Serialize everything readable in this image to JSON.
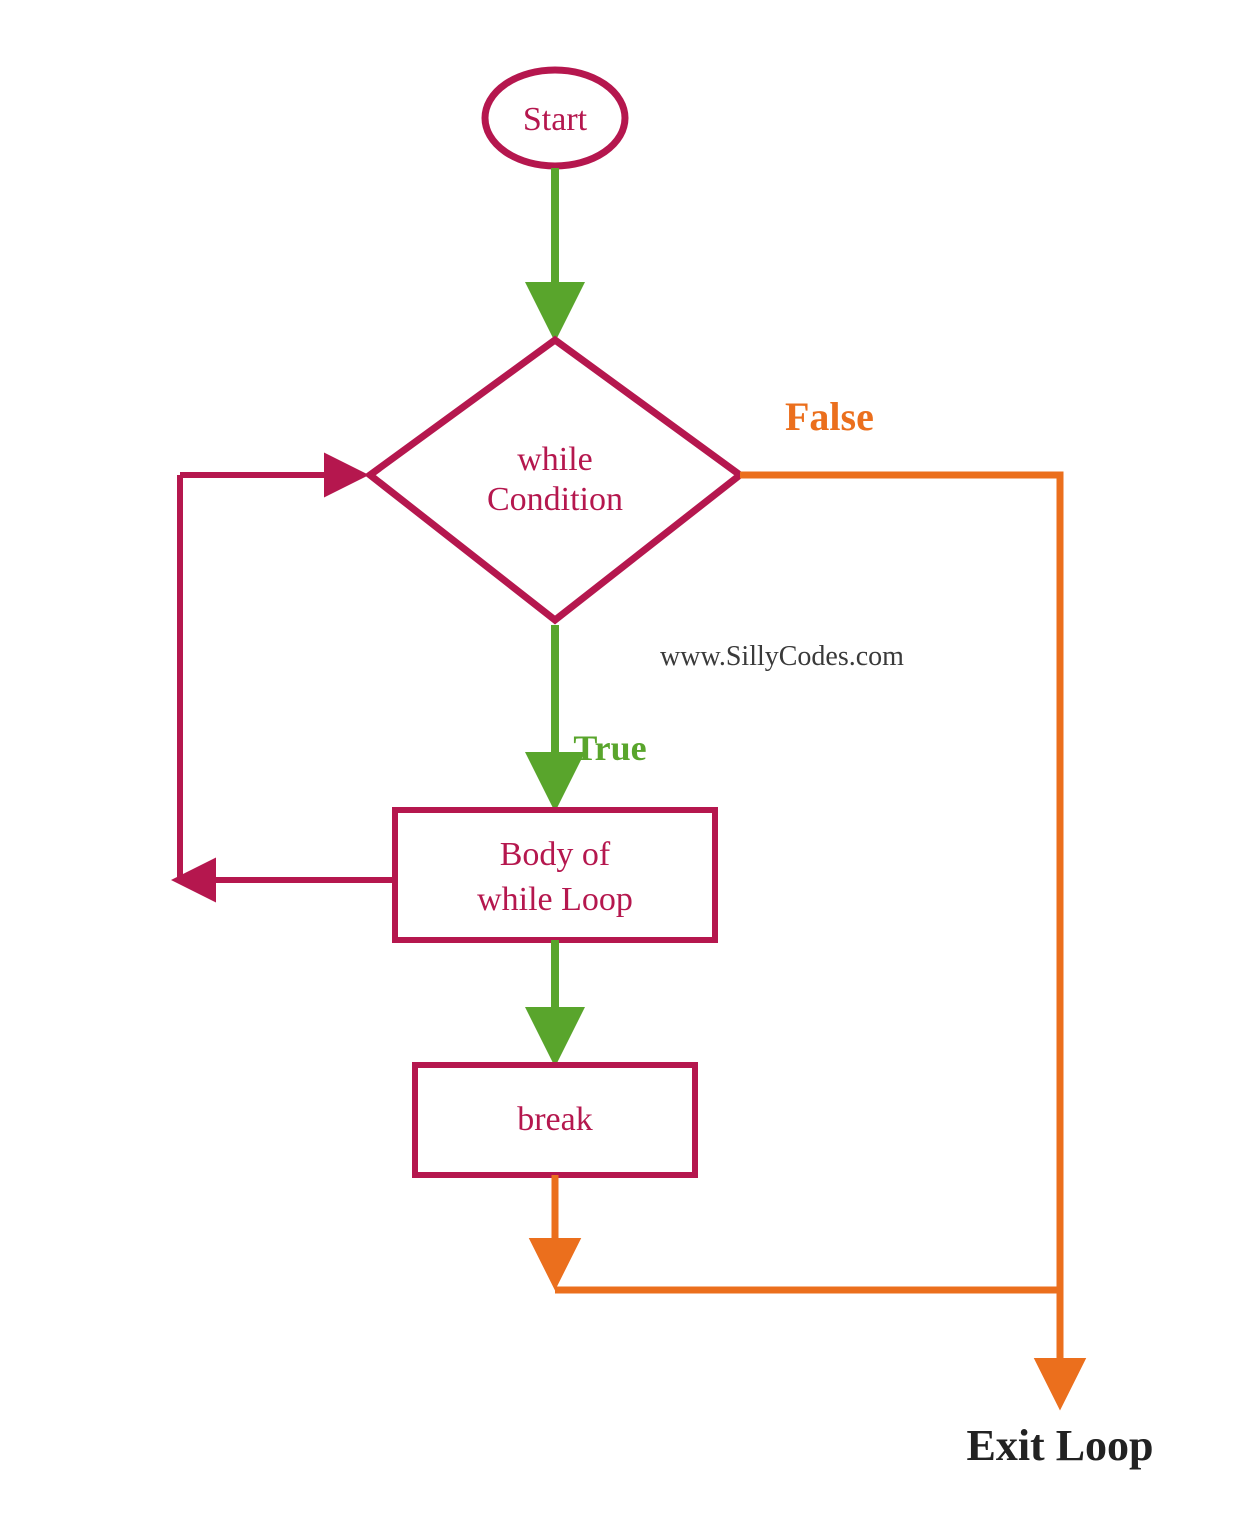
{
  "nodes": {
    "start": "Start",
    "condition_l1": "while",
    "condition_l2": "Condition",
    "body_l1": "Body of",
    "body_l2": "while Loop",
    "break": "break"
  },
  "edges": {
    "true": "True",
    "false": "False"
  },
  "exit": "Exit Loop",
  "watermark": "www.SillyCodes.com",
  "colors": {
    "magenta": "#b5174e",
    "green": "#59a52c",
    "orange": "#eb6f1d",
    "black": "#222222"
  }
}
